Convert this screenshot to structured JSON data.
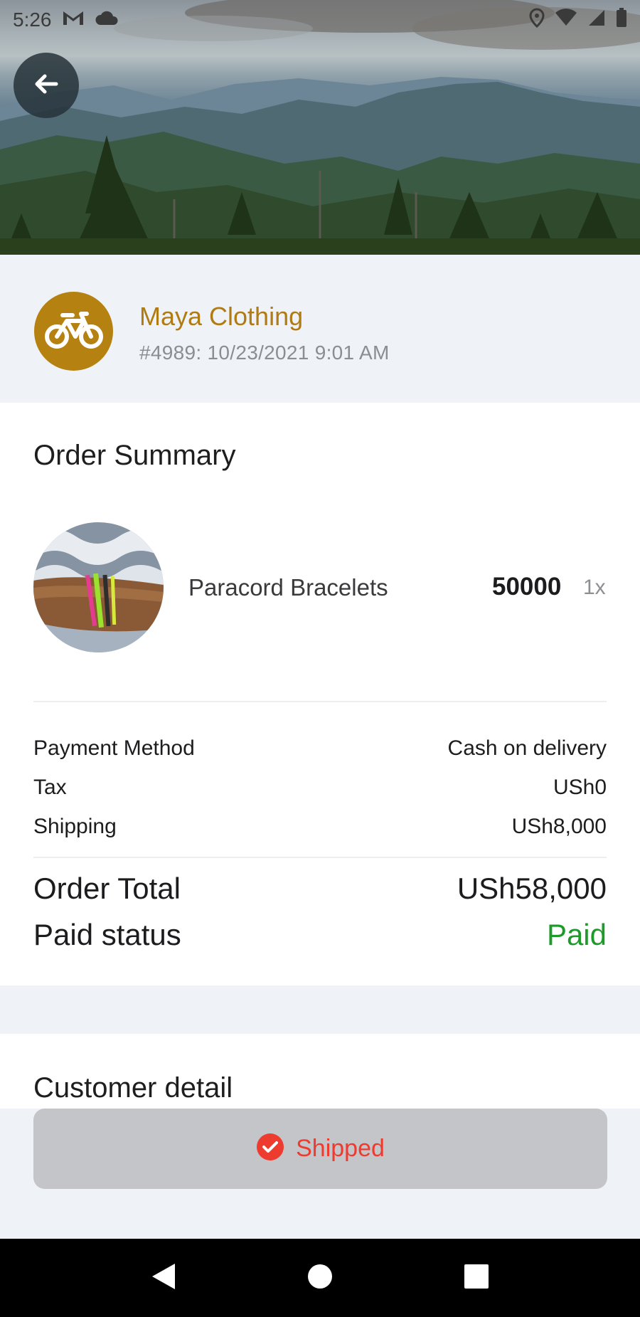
{
  "status_bar": {
    "time": "5:26",
    "left_icons": [
      "gmail-icon",
      "cloud-icon"
    ],
    "right_icons": [
      "location-icon",
      "wifi-icon",
      "cellular-icon",
      "battery-icon"
    ]
  },
  "header": {
    "back_icon": "arrow-left-icon"
  },
  "store": {
    "avatar_icon": "bicycle-icon",
    "avatar_color": "#b58110",
    "name": "Maya Clothing",
    "order_meta": "#4989: 10/23/2021 9:01 AM"
  },
  "order_summary": {
    "title": "Order Summary",
    "items": [
      {
        "name": "Paracord Bracelets",
        "price": "50000",
        "qty": "1x"
      }
    ],
    "payment_method_label": "Payment Method",
    "payment_method_value": "Cash on delivery",
    "tax_label": "Tax",
    "tax_value": "USh0",
    "shipping_label": "Shipping",
    "shipping_value": "USh8,000",
    "total_label": "Order Total",
    "total_value": "USh58,000",
    "paid_status_label": "Paid status",
    "paid_status_value": "Paid",
    "paid_color": "#1d9a2a"
  },
  "customer": {
    "title": "Customer detail"
  },
  "action": {
    "label": "Shipped",
    "icon": "check-circle-icon",
    "color": "#ee3b2f"
  },
  "nav": {
    "icons": [
      "back-triangle-icon",
      "home-circle-icon",
      "recents-square-icon"
    ]
  }
}
